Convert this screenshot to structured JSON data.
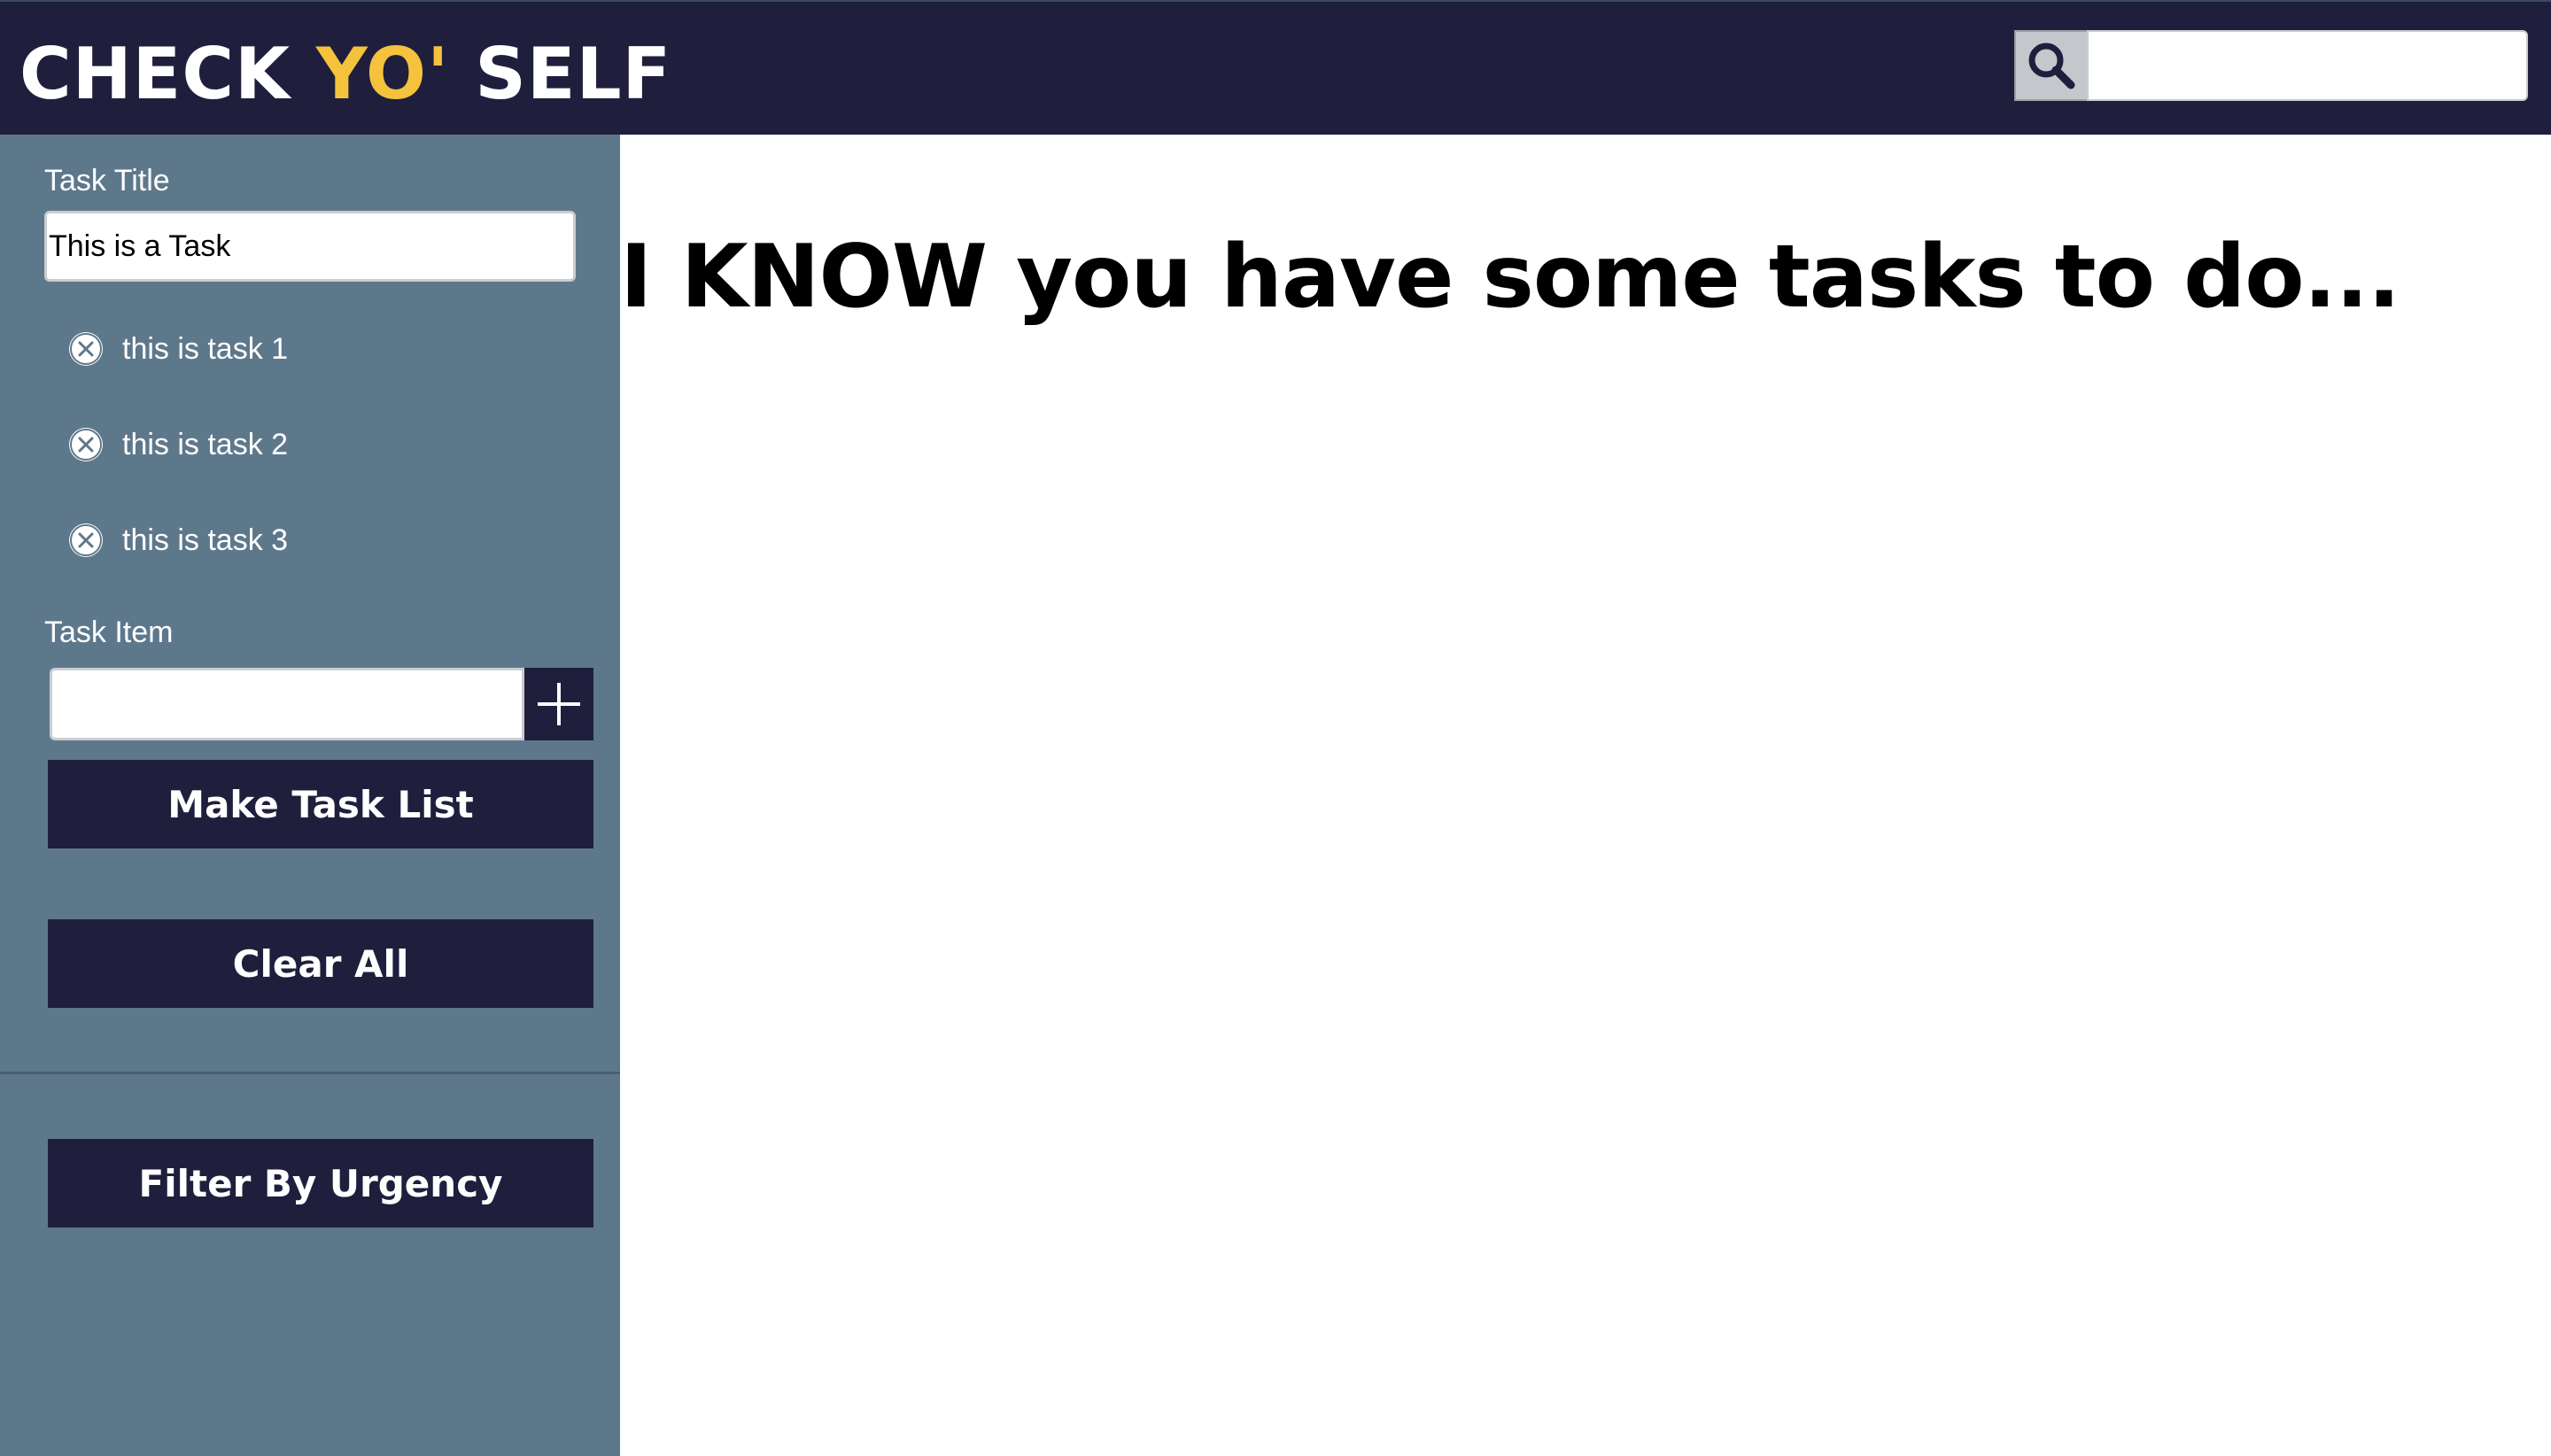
{
  "header": {
    "logo": {
      "part1": "CHECK ",
      "part2": "YO'",
      "part3": " SELF"
    },
    "search": {
      "icon": "magnifier-icon",
      "value": ""
    }
  },
  "sidebar": {
    "task_title_label": "Task Title",
    "task_title_value": "This is a Task",
    "tasks": [
      {
        "label": "this is task 1",
        "icon": "close-circle-icon"
      },
      {
        "label": "this is task 2",
        "icon": "close-circle-icon"
      },
      {
        "label": "this is task 3",
        "icon": "close-circle-icon"
      }
    ],
    "task_item_label": "Task Item",
    "task_item_value": "",
    "add_icon": "plus-icon",
    "make_task_list_label": "Make Task List",
    "clear_all_label": "Clear All",
    "filter_label": "Filter By Urgency"
  },
  "main": {
    "heading": "I KNOW you have some tasks to do..."
  },
  "colors": {
    "header_bg": "#1f1f3d",
    "sidebar_bg": "#5e788b",
    "accent": "#f4c23d",
    "button_bg": "#1f1f3d"
  }
}
